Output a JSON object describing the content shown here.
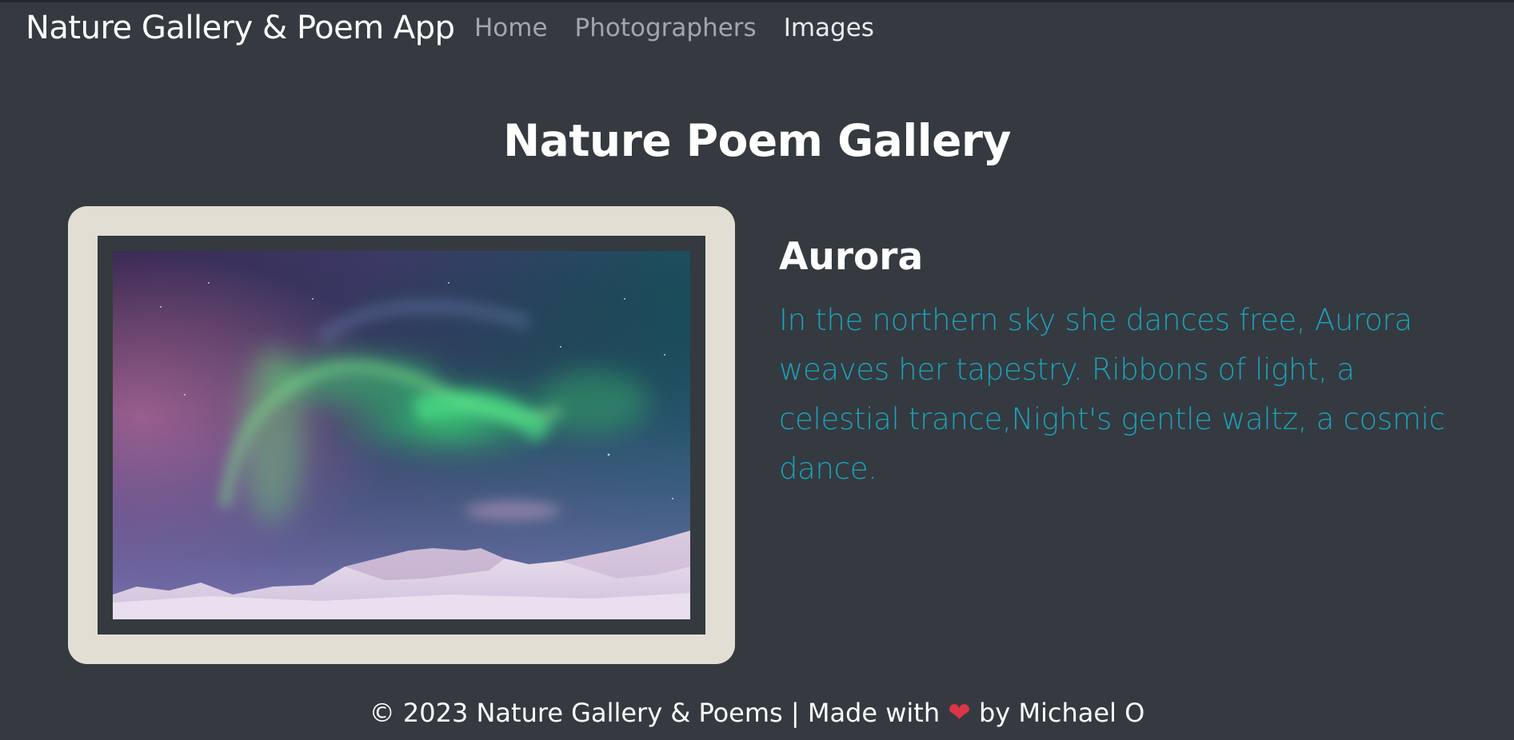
{
  "navbar": {
    "brand": "Nature Gallery & Poem App",
    "links": [
      {
        "label": "Home",
        "active": false
      },
      {
        "label": "Photographers",
        "active": false
      },
      {
        "label": "Images",
        "active": true
      }
    ]
  },
  "main": {
    "title": "Nature Poem Gallery",
    "gallery_item": {
      "image_alt": "Aurora",
      "poem_title": "Aurora",
      "poem_text": "In the northern sky she dances free, Aurora weaves her tapestry. Ribbons of light, a celestial trance,Night's gentle waltz, a cosmic dance."
    }
  },
  "footer": {
    "prefix": "© 2023 Nature Gallery & Poems | Made with",
    "heart_icon": "heart-icon",
    "suffix": "by Michael O"
  },
  "colors": {
    "background": "#343a40",
    "frame": "#e2ded3",
    "poem_text": "#1da1b8",
    "heart": "#dc3545"
  }
}
